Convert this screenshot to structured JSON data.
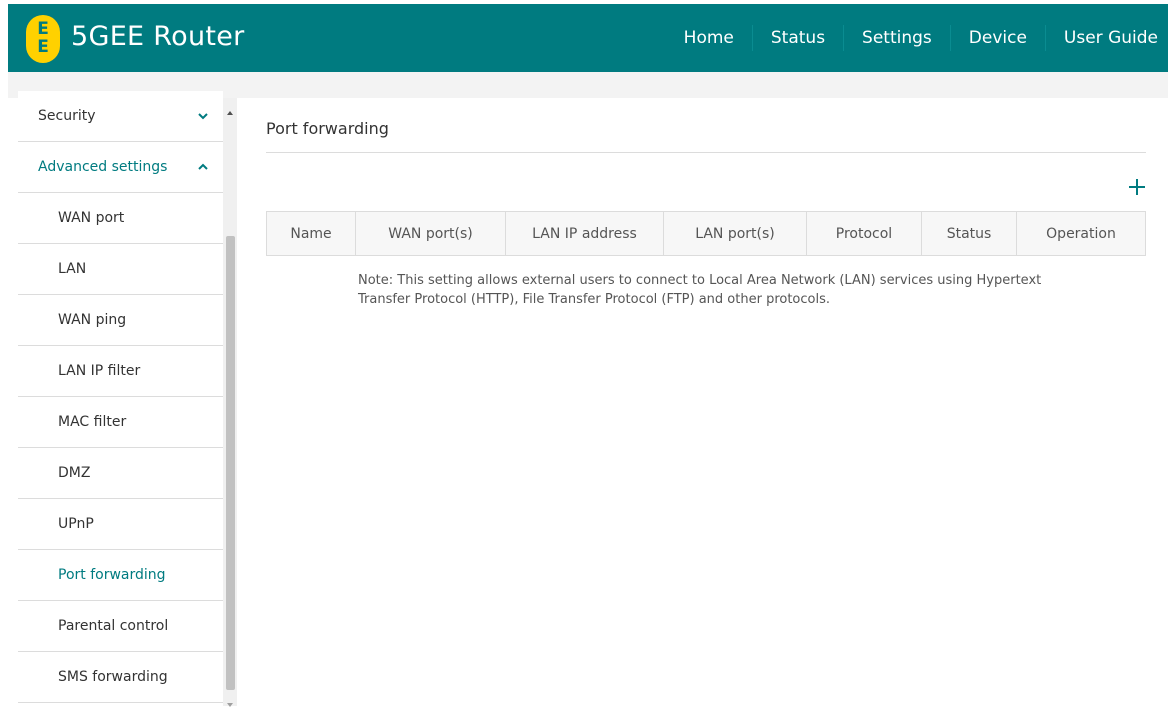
{
  "header": {
    "logo_letters": [
      "E",
      "E"
    ],
    "brand": "5GEE Router",
    "nav": [
      "Home",
      "Status",
      "Settings",
      "Device",
      "User Guide"
    ]
  },
  "sidebar": {
    "items": [
      {
        "label": "Security",
        "icon": "chevron-down-icon"
      },
      {
        "label": "Advanced settings",
        "icon": "chevron-up-icon"
      },
      {
        "label": "WAN port"
      },
      {
        "label": "LAN"
      },
      {
        "label": "WAN ping"
      },
      {
        "label": "LAN IP filter"
      },
      {
        "label": "MAC filter"
      },
      {
        "label": "DMZ"
      },
      {
        "label": "UPnP"
      },
      {
        "label": "Port forwarding",
        "active": true
      },
      {
        "label": "Parental control"
      },
      {
        "label": "SMS forwarding"
      }
    ]
  },
  "main": {
    "title": "Port forwarding",
    "add_icon": "plus-icon",
    "table": {
      "headers": [
        "Name",
        "WAN port(s)",
        "LAN IP address",
        "LAN port(s)",
        "Protocol",
        "Status",
        "Operation"
      ]
    },
    "note": "Note: This setting allows external users to connect to Local Area Network (LAN) services using Hypertext Transfer Protocol (HTTP), File Transfer Protocol (FTP) and other protocols."
  },
  "colors": {
    "brand": "#007b80",
    "logo": "#ffd100",
    "active_text": "#007b80"
  }
}
